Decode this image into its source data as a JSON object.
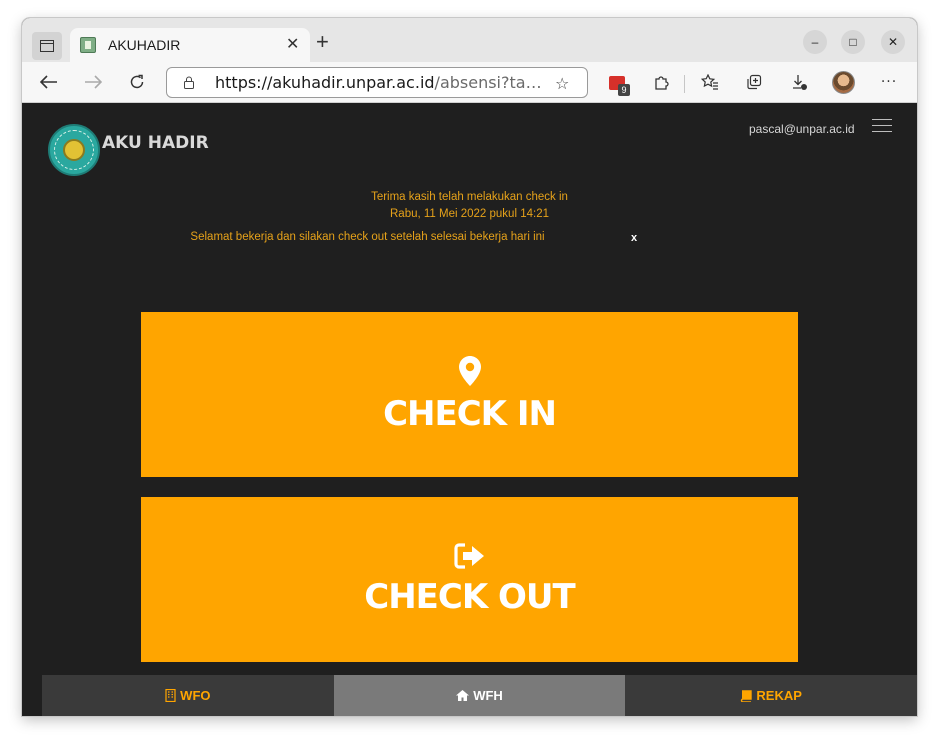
{
  "browser": {
    "tab_title": "AKUHADIR",
    "tab_close": "✕",
    "new_tab": "+",
    "url_host": "https://akuhadir.unpar.ac.id",
    "url_path": "/absensi?ta…",
    "extension_badge": "9",
    "window_controls": {
      "minimize": "–",
      "maximize": "□",
      "close": "✕"
    }
  },
  "header": {
    "logo_text": "AKU HADIR",
    "user_email": "pascal@unpar.ac.id"
  },
  "notice": {
    "line1": "Terima kasih telah melakukan check in",
    "line2": "Rabu, 11 Mei 2022 pukul 14:21",
    "line3": "Selamat bekerja dan silakan check out setelah selesai bekerja hari ini",
    "close": "x"
  },
  "actions": {
    "check_in": "CHECK IN",
    "check_out": "CHECK OUT"
  },
  "bottom_nav": {
    "items": [
      {
        "label": "WFO",
        "icon": "building-icon",
        "active": false
      },
      {
        "label": "WFH",
        "icon": "home-icon",
        "active": true
      },
      {
        "label": "REKAP",
        "icon": "book-icon",
        "active": false
      }
    ]
  },
  "colors": {
    "accent": "#ffa500",
    "page_bg": "#1f1f1f",
    "notice_text": "#e6a21a"
  }
}
